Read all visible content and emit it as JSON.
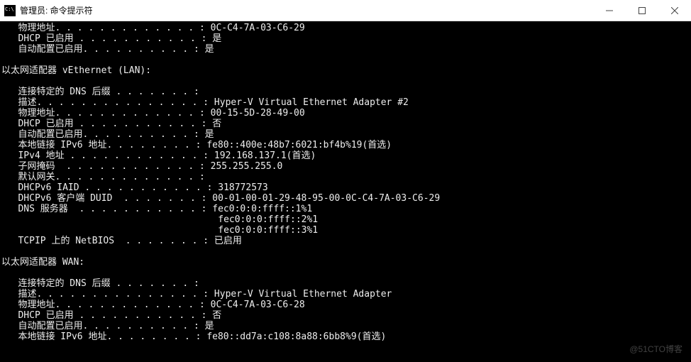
{
  "window": {
    "title": "管理员: 命令提示符"
  },
  "terminal": {
    "lines": [
      "   物理地址. . . . . . . . . . . . . : 0C-C4-7A-03-C6-29",
      "   DHCP 已启用 . . . . . . . . . . . : 是",
      "   自动配置已启用. . . . . . . . . . : 是",
      "",
      "以太网适配器 vEthernet (LAN):",
      "",
      "   连接特定的 DNS 后缀 . . . . . . . :",
      "   描述. . . . . . . . . . . . . . . : Hyper-V Virtual Ethernet Adapter #2",
      "   物理地址. . . . . . . . . . . . . : 00-15-5D-28-49-00",
      "   DHCP 已启用 . . . . . . . . . . . : 否",
      "   自动配置已启用. . . . . . . . . . : 是",
      "   本地链接 IPv6 地址. . . . . . . . : fe80::400e:48b7:6021:bf4b%19(首选)",
      "   IPv4 地址 . . . . . . . . . . . . : 192.168.137.1(首选)",
      "   子网掩码  . . . . . . . . . . . . : 255.255.255.0",
      "   默认网关. . . . . . . . . . . . . :",
      "   DHCPv6 IAID . . . . . . . . . . . : 318772573",
      "   DHCPv6 客户端 DUID  . . . . . . . : 00-01-00-01-29-48-95-00-0C-C4-7A-03-C6-29",
      "   DNS 服务器  . . . . . . . . . . . : fec0:0:0:ffff::1%1",
      "                                       fec0:0:0:ffff::2%1",
      "                                       fec0:0:0:ffff::3%1",
      "   TCPIP 上的 NetBIOS  . . . . . . . : 已启用",
      "",
      "以太网适配器 WAN:",
      "",
      "   连接特定的 DNS 后缀 . . . . . . . :",
      "   描述. . . . . . . . . . . . . . . : Hyper-V Virtual Ethernet Adapter",
      "   物理地址. . . . . . . . . . . . . : 0C-C4-7A-03-C6-28",
      "   DHCP 已启用 . . . . . . . . . . . : 否",
      "   自动配置已启用. . . . . . . . . . : 是",
      "   本地链接 IPv6 地址. . . . . . . . : fe80::dd7a:c108:8a88:6bb8%9(首选)"
    ]
  },
  "watermark": "@51CTO博客"
}
